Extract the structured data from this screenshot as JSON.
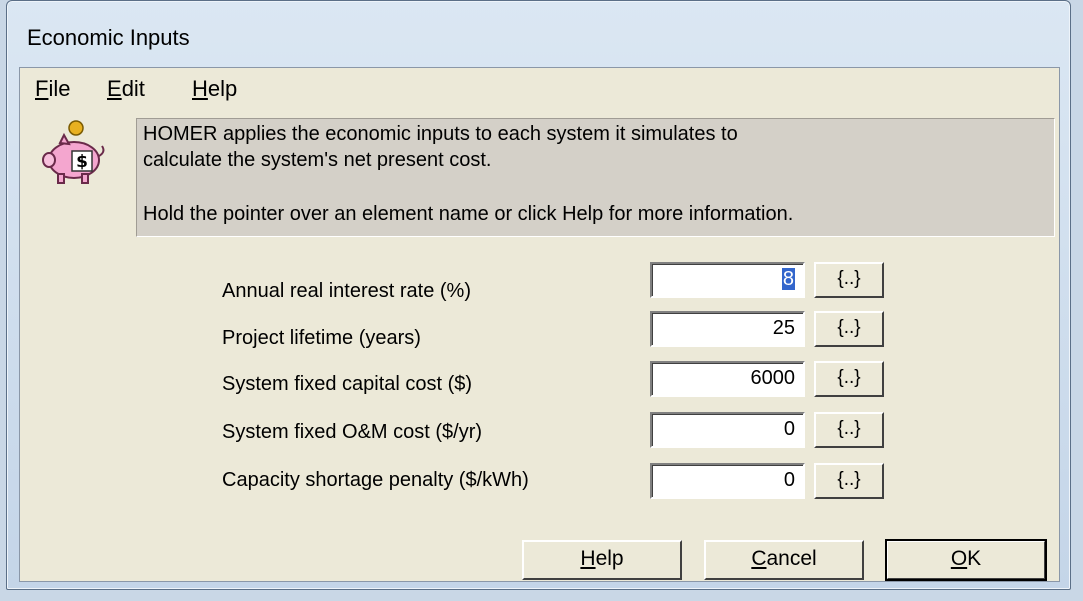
{
  "window": {
    "title": "Economic Inputs"
  },
  "menubar": {
    "items": [
      {
        "accel": "F",
        "rest": "ile"
      },
      {
        "accel": "E",
        "rest": "dit"
      },
      {
        "accel": "H",
        "rest": "elp"
      }
    ]
  },
  "info": {
    "icon": "piggy-bank-dollar-icon",
    "line1": "HOMER applies the economic inputs to each system it simulates to",
    "line2": "calculate the system's net present cost.",
    "line3": "Hold the pointer over an element name or click Help for more information."
  },
  "fields": [
    {
      "label": "Annual real interest rate (%)",
      "value": "8",
      "button": "{..}",
      "selected": true
    },
    {
      "label": "Project lifetime (years)",
      "value": "25",
      "button": "{..}"
    },
    {
      "label": "System fixed capital cost ($)",
      "value": "6000",
      "button": "{..}"
    },
    {
      "label": "System fixed O&M cost ($/yr)",
      "value": "0",
      "button": "{..}"
    },
    {
      "label": "Capacity shortage penalty ($/kWh)",
      "value": "0",
      "button": "{..}"
    }
  ],
  "buttons": {
    "help": {
      "accel": "H",
      "rest": "elp"
    },
    "cancel": {
      "accel": "C",
      "rest": "ancel"
    },
    "ok": {
      "accel": "O",
      "rest": "K"
    }
  }
}
